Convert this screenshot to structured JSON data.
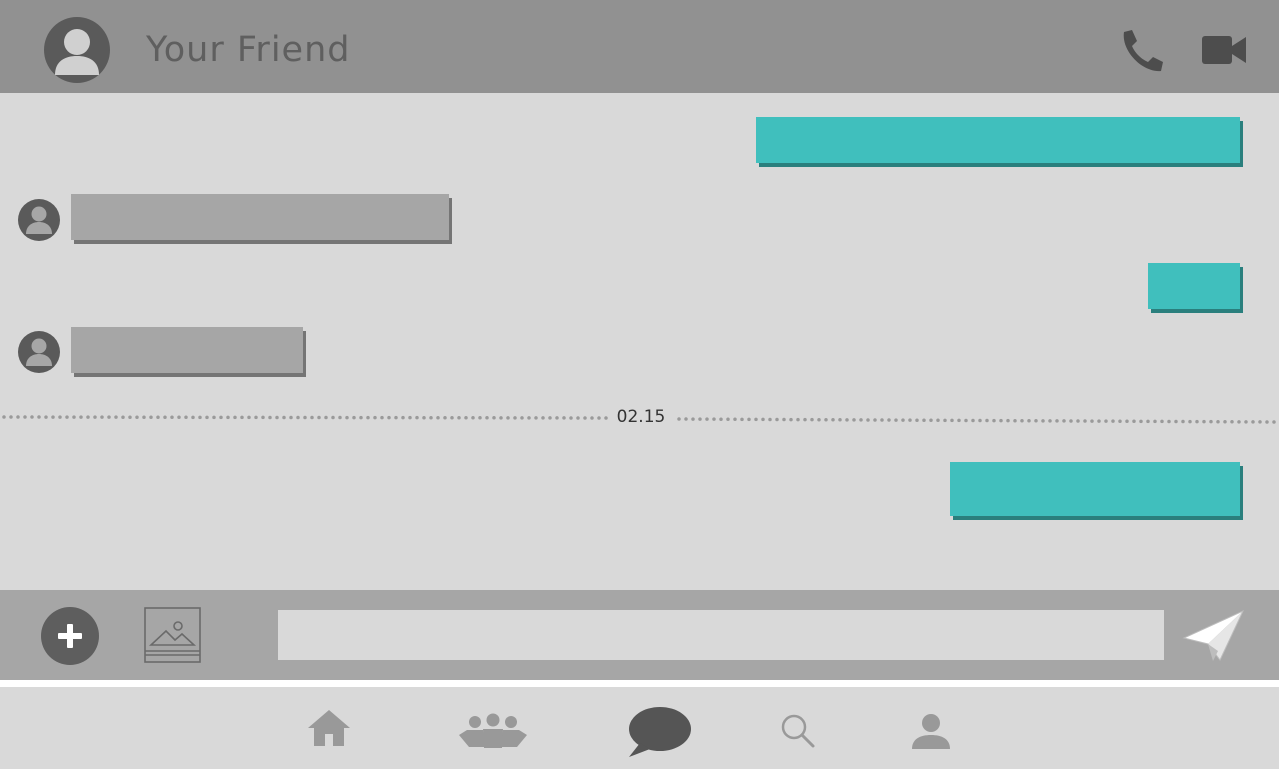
{
  "header": {
    "contact_name": "Your Friend",
    "icons": [
      "user-avatar-icon",
      "phone-icon",
      "video-camera-icon"
    ]
  },
  "chat": {
    "messages": [
      {
        "side": "outgoing",
        "text": ""
      },
      {
        "side": "incoming",
        "text": ""
      },
      {
        "side": "outgoing",
        "text": ""
      },
      {
        "side": "incoming",
        "text": ""
      },
      {
        "side": "outgoing",
        "text": ""
      }
    ],
    "date_separator": "02.15"
  },
  "composer": {
    "input_value": "",
    "input_placeholder": "",
    "icons": [
      "plus-icon",
      "image-icon",
      "send-icon"
    ]
  },
  "bottom_nav": {
    "items": [
      {
        "icon": "home-icon",
        "active": false
      },
      {
        "icon": "friends-icon",
        "active": false
      },
      {
        "icon": "chat-icon",
        "active": true
      },
      {
        "icon": "search-icon",
        "active": false
      },
      {
        "icon": "profile-icon",
        "active": false
      }
    ]
  },
  "colors": {
    "header_bg": "#919191",
    "chat_bg": "#d9d9d9",
    "outgoing_bubble": "#40bfbd",
    "incoming_bubble": "#a6a6a6",
    "composer_bg": "#a6a6a6",
    "active_nav_icon": "#555555",
    "inactive_nav_icon": "#999999"
  }
}
